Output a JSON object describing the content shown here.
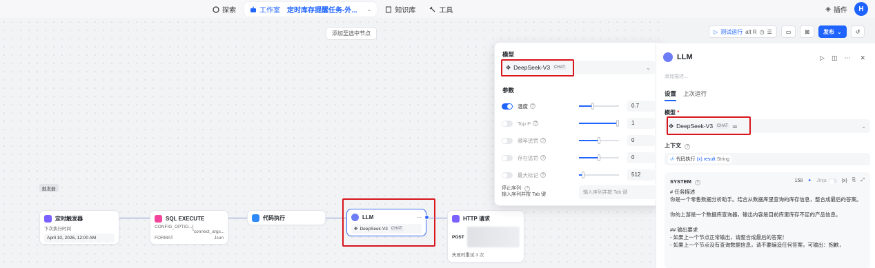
{
  "topbar": {
    "nav": [
      {
        "label": "探索"
      },
      {
        "label": "工作室",
        "sub": "定时库存提醒任务-外..."
      },
      {
        "label": "知识库"
      },
      {
        "label": "工具"
      }
    ],
    "plugin_label": "插件",
    "avatar_letter": "H"
  },
  "canvas": {
    "add_node_label": "添加至选中节点",
    "group_tag": "触发器",
    "nodes": {
      "trigger": {
        "title": "定时触发器",
        "row_label": "下次执行时间",
        "value": "April 10, 2026, 12:00 AM"
      },
      "sql": {
        "title": "SQL EXECUTE",
        "row1_key": "CONFIG_OPTIO...",
        "row1_val": "{ \"connect_args...",
        "row2_key": "FORMAT",
        "row2_val": "Json"
      },
      "code": {
        "title": "代码执行"
      },
      "llm": {
        "title": "LLM",
        "model": "DeepSeek-V3",
        "badge": "CHAT"
      },
      "http": {
        "title": "HTTP 请求",
        "method": "POST",
        "retry": "失败时重试 3 次"
      }
    }
  },
  "toolbar": {
    "test_run": "测试运行",
    "shortcut": "alt R",
    "publish": "发布"
  },
  "popover": {
    "model_label": "模型",
    "model_name": "DeepSeek-V3",
    "model_badge": "CHAT",
    "params_label": "参数",
    "params": [
      {
        "label": "温度",
        "enabled": true,
        "value": "0.7",
        "fraction": 0.35
      },
      {
        "label": "Top P",
        "enabled": false,
        "value": "1",
        "fraction": 1.0
      },
      {
        "label": "频率惩罚",
        "enabled": false,
        "value": "0",
        "fraction": 0.5
      },
      {
        "label": "存在惩罚",
        "enabled": false,
        "value": "0",
        "fraction": 0.5
      },
      {
        "label": "最大标记",
        "enabled": false,
        "value": "512",
        "fraction": 0.1
      }
    ],
    "stop_label": "停止序列",
    "stop_hint": "输入序列并按 Tab 键",
    "stop_placeholder": "输入序列并按 Tab 键"
  },
  "panel": {
    "title": "LLM",
    "description_placeholder": "添加描述...",
    "tabs": [
      "设置",
      "上次运行"
    ],
    "model_label": "模型",
    "model_name": "DeepSeek-V3",
    "model_badge": "CHAT",
    "context_label": "上下文",
    "context_source": "代码执行",
    "context_var": "(x) result",
    "context_type": "String",
    "system_title": "SYSTEM",
    "system_count": "158",
    "system_jinja": "Jinja",
    "system_text": "# 任务描述\n你是一个零售数据分析助手。结合从数据库里查询的库存信息，整合成最后的答案。\n\n你的上游是一个数据库查询器，输出内容是目前库里库存不足的产品信息。\n\n## 输出要求\n- 如果上一个节点正常输出，请整合成最后的答案！\n- 如果上一个节点没有查询数据信息，请不要编造任何答案，可输出：抱歉，"
  },
  "colors": {
    "accent": "#1f64ff",
    "highlight": "#d8141b"
  }
}
